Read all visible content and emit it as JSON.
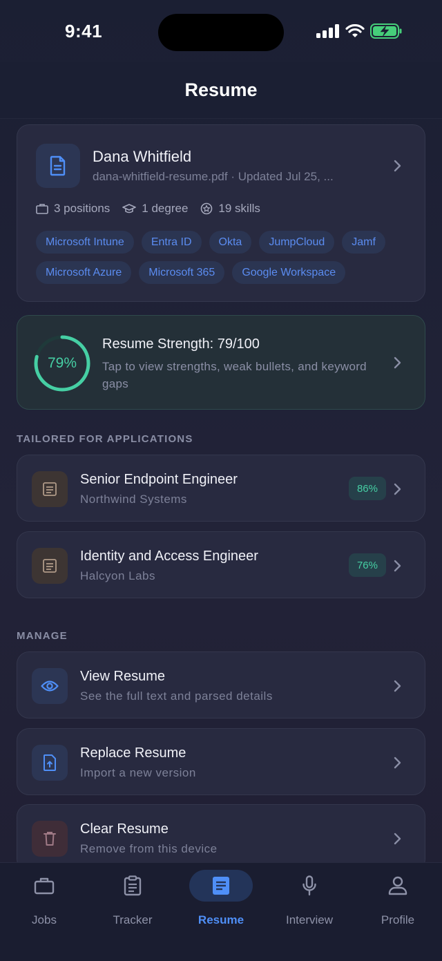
{
  "status_bar": {
    "time": "9:41"
  },
  "header": {
    "title": "Resume"
  },
  "resume": {
    "name": "Dana Whitfield",
    "file_line": "dana-whitfield-resume.pdf · Updated Jul 25, ...",
    "positions": "3 positions",
    "degree": "1 degree",
    "skills": "19 skills",
    "chips": [
      "Microsoft Intune",
      "Entra ID",
      "Okta",
      "JumpCloud",
      "Jamf",
      "Microsoft Azure",
      "Microsoft 365",
      "Google Workspace"
    ]
  },
  "strength": {
    "percent_label": "79%",
    "score": 0.79,
    "title": "Resume Strength: 79/100",
    "description": "Tap to view strengths, weak bullets, and keyword gaps"
  },
  "tailored": {
    "section_label": "TAILORED FOR APPLICATIONS",
    "items": [
      {
        "title": "Senior Endpoint Engineer",
        "company": "Northwind Systems",
        "match": "86%"
      },
      {
        "title": "Identity and Access Engineer",
        "company": "Halcyon Labs",
        "match": "76%"
      }
    ]
  },
  "manage": {
    "section_label": "MANAGE",
    "items": [
      {
        "title": "View Resume",
        "subtitle": "See the full text and parsed details",
        "icon": "eye-icon"
      },
      {
        "title": "Replace Resume",
        "subtitle": "Import a new version",
        "icon": "file-upload-icon"
      },
      {
        "title": "Clear Resume",
        "subtitle": "Remove from this device",
        "icon": "trash-icon"
      }
    ]
  },
  "tabs": [
    {
      "label": "Jobs",
      "icon": "briefcase-icon"
    },
    {
      "label": "Tracker",
      "icon": "clipboard-icon"
    },
    {
      "label": "Resume",
      "icon": "document-icon",
      "active": true
    },
    {
      "label": "Interview",
      "icon": "microphone-icon"
    },
    {
      "label": "Profile",
      "icon": "person-icon"
    }
  ],
  "colors": {
    "accent": "#4f8ff7",
    "success": "#46cfa4",
    "background": "#1e2034"
  }
}
